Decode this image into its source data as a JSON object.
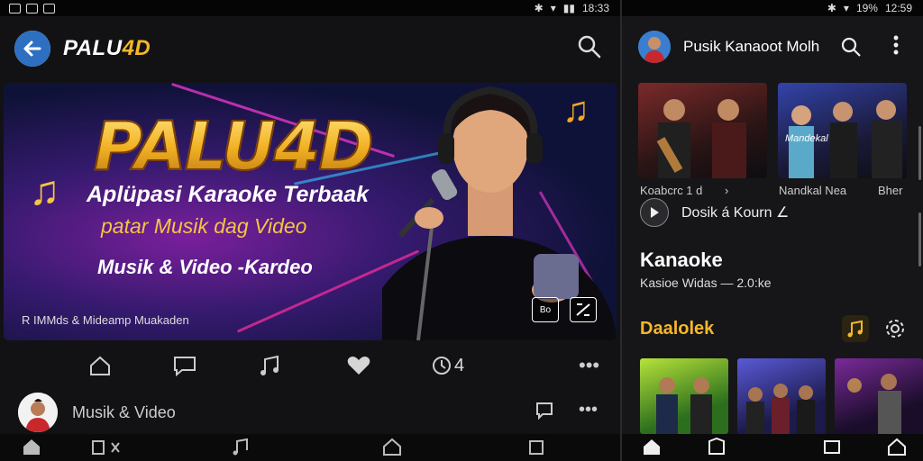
{
  "left": {
    "status_time": "18:33",
    "app_title_main": "PALU",
    "app_title_accent": "4D",
    "hero": {
      "title": "PALU4D",
      "line1": "Aplüpasi Karaoke Terbaak",
      "line2": "patar Musik dag Video",
      "line3": "Musik & Video -Kardeo",
      "footer": "R IMMds & Mideamp Muakaden",
      "badge1": "Bo",
      "badge2": ""
    },
    "actions": {
      "views_label": "4"
    },
    "channel": {
      "name": "Musik & Video"
    }
  },
  "right": {
    "status_time": "12:59",
    "status_battery": "19%",
    "header_title": "Pusik Kanaoot Molh",
    "thumb_captions": [
      "Koabcrc 1 d",
      "Nandkal Nea",
      "Bher"
    ],
    "chip_label": "Dosik á Kourn ∠",
    "section_title": "Kanaoke",
    "section_sub": "Kasioe Widas — 2.0:ke",
    "thumb_overlay": "Mandekal",
    "section2_title": "Daalolek"
  },
  "colors": {
    "accent": "#f5b72a",
    "background": "#121214"
  }
}
